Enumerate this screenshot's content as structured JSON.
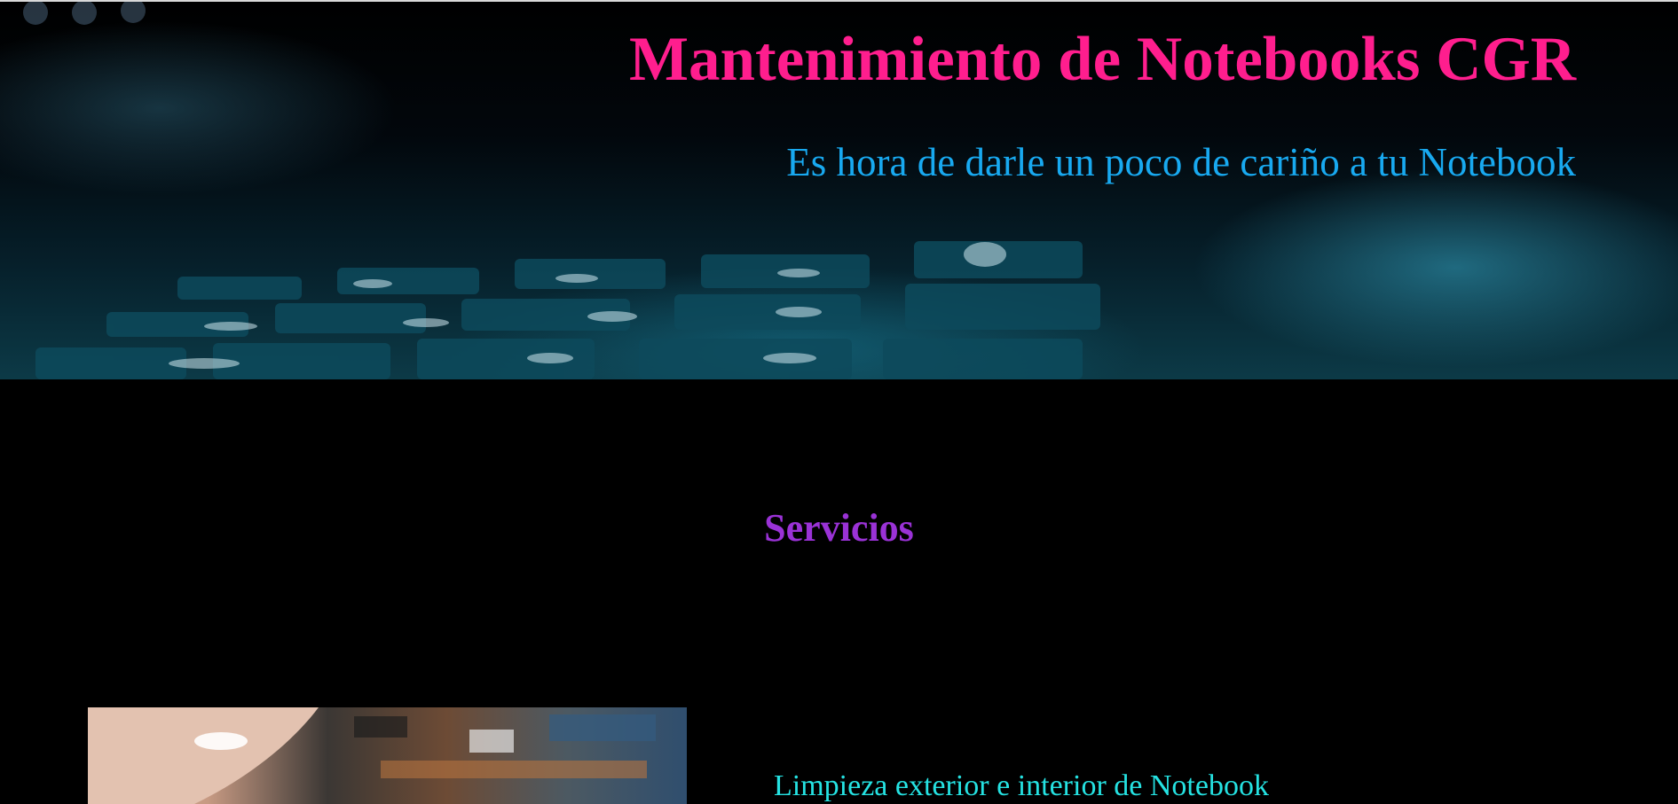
{
  "header": {
    "title": "Mantenimiento de Notebooks CGR",
    "subtitle": "Es hora de darle un poco de cariño a tu Notebook",
    "background_image": "laptop-keyboard-photo"
  },
  "main": {
    "section_title": "Servicios",
    "services": [
      {
        "image": "notebook-cleaning-photo",
        "label": "Limpieza exterior e interior de Notebook"
      }
    ]
  },
  "colors": {
    "page_background": "#000000",
    "title": "#ff1e8e",
    "subtitle": "#18a9f0",
    "section_title": "#9a32d6",
    "service_text": "#25e2e2"
  }
}
